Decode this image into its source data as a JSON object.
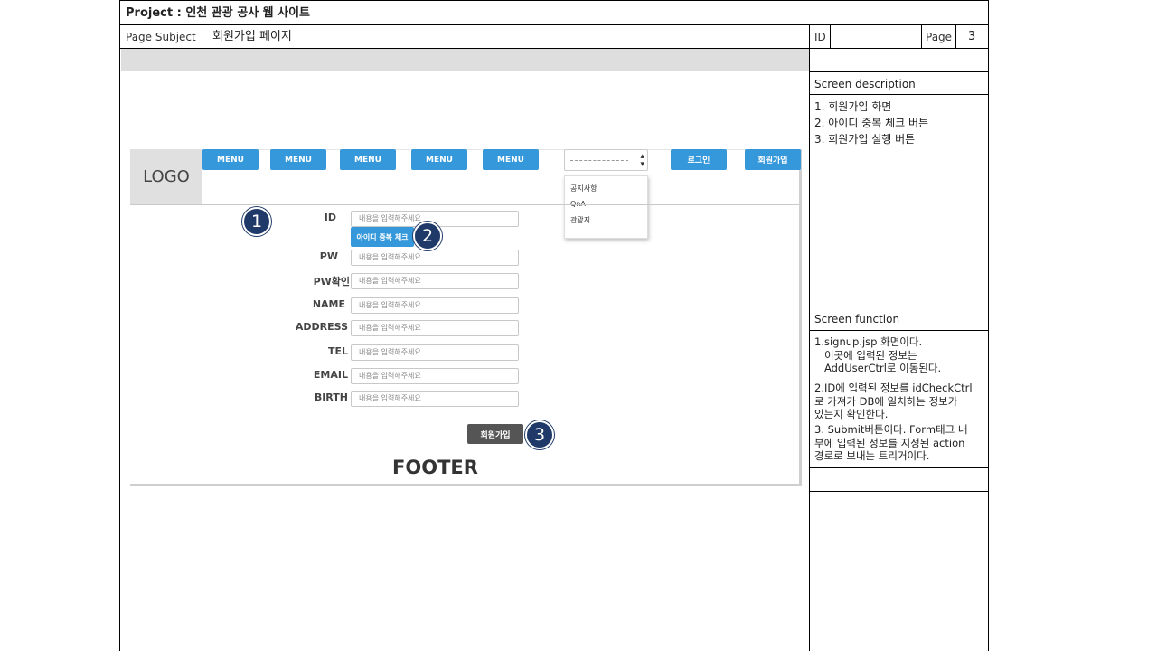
{
  "doc": {
    "project_label": "Project : 인천 관광 공사 웹 사이트",
    "page_subject_label": "Page Subject",
    "page_subject_value": "회원가입 페이지",
    "id_label": "ID",
    "id_value": "",
    "page_label": "Page",
    "page_value": "3"
  },
  "mockup": {
    "logo": "LOGO",
    "menu_items": [
      "MENU",
      "MENU",
      "MENU",
      "MENU",
      "MENU"
    ],
    "login_button": "로그인",
    "signup_nav_button": "회원가입",
    "dropdown_items": [
      "공지사항",
      "QnA",
      "관광지"
    ],
    "form": {
      "placeholder": "내용을 입력해주세요",
      "labels": [
        "ID",
        "PW",
        "PW확인",
        "NAME",
        "ADDRESS",
        "TEL",
        "EMAIL",
        "BIRTH"
      ],
      "id_check_button": "아이디 중복 체크",
      "submit_button": "회원가입"
    },
    "footer": "FOOTER",
    "badges": [
      "1",
      "2",
      "3"
    ]
  },
  "screen_description": {
    "title": "Screen description",
    "lines": [
      "1. 회원가입 화면",
      "2. 아이디 중복 체크 버튼",
      "3. 회원가입 실행 버튼"
    ]
  },
  "screen_function": {
    "title": "Screen function",
    "lines": [
      "1.signup.jsp 화면이다.",
      "   이곳에 입력된 정보는",
      "   AddUserCtrl로 이동된다.",
      "2.ID에 입력된 정보를 idCheckCtrl",
      "로 가져가 DB에 일치하는 정보가",
      "있는지 확인한다.",
      "3. Submit버튼이다. Form태그 내",
      "부에 입력된 정보를 지정된 action",
      "경로로 보내는 트리거이다."
    ]
  }
}
